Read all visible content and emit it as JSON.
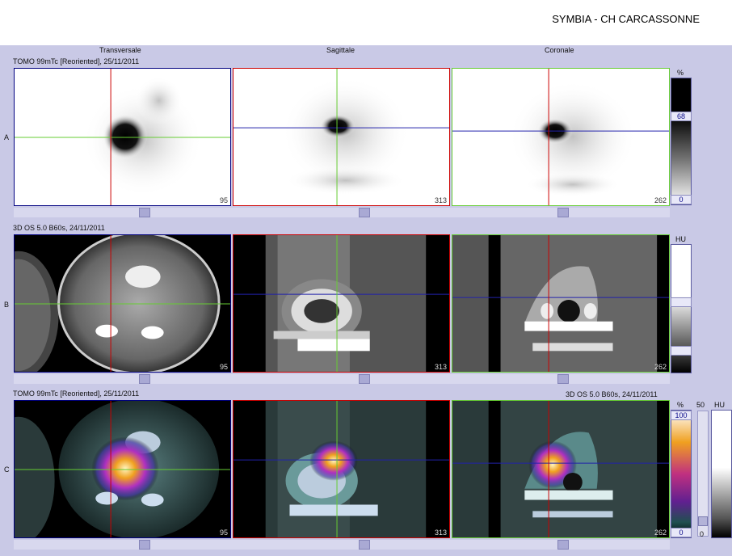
{
  "header": {
    "title": "SYMBIA - CH CARCASSONNE"
  },
  "columns": [
    "Transversale",
    "Sagittale",
    "Coronale"
  ],
  "rows": [
    {
      "label": "A",
      "series": "TOMO 99mTc [Reoriented], 25/11/2011",
      "slices": [
        "95",
        "313",
        "262"
      ]
    },
    {
      "label": "B",
      "series": "3D  OS  5.0  B60s, 24/11/2011",
      "slices": [
        "95",
        "313",
        "262"
      ]
    },
    {
      "label": "C",
      "series": "TOMO 99mTc [Reoriented], 25/11/2011",
      "series_right": "3D  OS  5.0  B60s, 24/11/2011",
      "slices": [
        "95",
        "313",
        "262"
      ]
    }
  ],
  "colorbars": {
    "a": {
      "unit": "%",
      "top": "68",
      "bottom": "0"
    },
    "b": {
      "unit": "HU"
    },
    "c": {
      "unit": "%",
      "top": "100",
      "bottom": "0",
      "mid": "50",
      "mid_bottom": "0",
      "unit2": "HU"
    }
  },
  "colors": {
    "background": "#c9c9e6",
    "crosshair_red": "#cc0000",
    "crosshair_green": "#66cc33",
    "crosshair_blue": "#2222aa"
  }
}
